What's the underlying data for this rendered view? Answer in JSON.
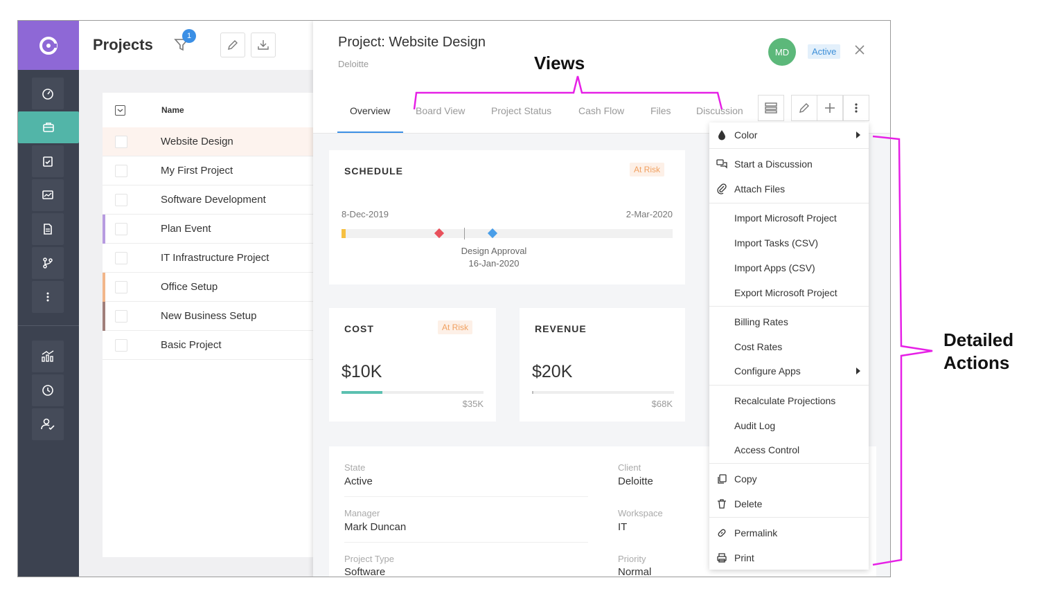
{
  "list": {
    "title": "Projects",
    "filter_count": "1",
    "column_name": "Name",
    "rows": [
      {
        "name": "Website Design",
        "stripe": ""
      },
      {
        "name": "My First Project",
        "stripe": ""
      },
      {
        "name": "Software Development",
        "stripe": ""
      },
      {
        "name": "Plan Event",
        "stripe": "#b79be0"
      },
      {
        "name": "IT Infrastructure Project",
        "stripe": ""
      },
      {
        "name": "Office Setup",
        "stripe": "#f2b68a"
      },
      {
        "name": "New Business Setup",
        "stripe": "#a07f7a"
      },
      {
        "name": "Basic Project",
        "stripe": ""
      }
    ]
  },
  "panel": {
    "title": "Project: Website Design",
    "client_sub": "Deloitte",
    "avatar": "MD",
    "status": "Active",
    "tabs": [
      "Overview",
      "Board View",
      "Project Status",
      "Cash Flow",
      "Files",
      "Discussion"
    ]
  },
  "schedule": {
    "title": "SCHEDULE",
    "risk": "At Risk",
    "start": "8-Dec-2019",
    "end": "2-Mar-2020",
    "milestone_name": "Design Approval",
    "milestone_date": "16-Jan-2020"
  },
  "cost": {
    "title": "COST",
    "risk": "At Risk",
    "value": "$10K",
    "max": "$35K",
    "progress": 0.29
  },
  "revenue": {
    "title": "REVENUE",
    "value": "$20K",
    "max": "$68K",
    "progress": 0.01
  },
  "details": {
    "state_label": "State",
    "state": "Active",
    "client_label": "Client",
    "client": "Deloitte",
    "manager_label": "Manager",
    "manager": "Mark Duncan",
    "workspace_label": "Workspace",
    "workspace": "IT",
    "type_label": "Project Type",
    "type": "Software",
    "priority_label": "Priority",
    "priority": "Normal"
  },
  "menu": {
    "color": "Color",
    "start_discussion": "Start a Discussion",
    "attach_files": "Attach Files",
    "import_ms_project": "Import Microsoft Project",
    "import_tasks": "Import Tasks (CSV)",
    "import_apps": "Import Apps (CSV)",
    "export_ms_project": "Export Microsoft Project",
    "billing_rates": "Billing Rates",
    "cost_rates": "Cost Rates",
    "configure_apps": "Configure Apps",
    "recalculate": "Recalculate Projections",
    "audit_log": "Audit Log",
    "access_control": "Access Control",
    "copy": "Copy",
    "delete": "Delete",
    "permalink": "Permalink",
    "print": "Print"
  },
  "annotations": {
    "views": "Views",
    "detailed_line1": "Detailed",
    "detailed_line2": "Actions"
  },
  "colors": {
    "accent": "#3b8fe5",
    "rail": "#3c4250",
    "logo": "#8e68d6",
    "active_nav": "#52b5a8",
    "annotation": "#e620e6"
  }
}
